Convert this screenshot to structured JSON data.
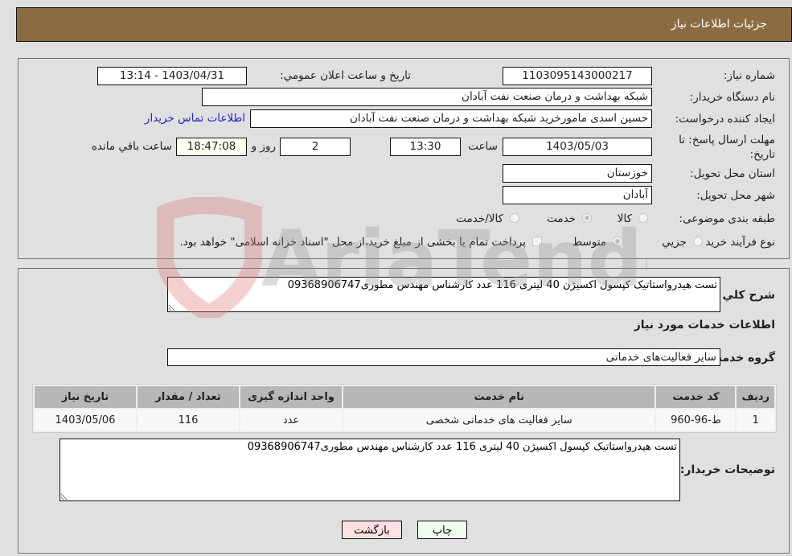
{
  "header": {
    "title": "جزئیات اطلاعات نیاز"
  },
  "details": {
    "need_number_label": "شماره نیاز:",
    "need_number": "1103095143000217",
    "announce_label": "تاریخ و ساعت اعلان عمومي:",
    "announce_value": "1403/04/31 - 13:14",
    "buyer_org_label": "نام دستگاه خریدار:",
    "buyer_org": "شبکه بهداشت و درمان صنعت نفت آبادان",
    "creator_label": "ایجاد کننده درخواست:",
    "creator": "حسین اسدی مامورخرید شبکه بهداشت و درمان صنعت نفت آبادان",
    "contact_link": "اطلاعات تماس خریدار",
    "deadline_label": "مهلت ارسال پاسخ: تا تاریخ:",
    "deadline_date": "1403/05/03",
    "time_label": "ساعت",
    "deadline_time": "13:30",
    "days_value": "2",
    "days_label": "روز و",
    "remaining_time": "18:47:08",
    "remaining_label": "ساعت باقي مانده",
    "province_label": "استان محل تحویل:",
    "province": "خوزستان",
    "city_label": "شهر محل تحویل:",
    "city": "آبادان",
    "category_label": "طبقه بندی موضوعی:",
    "category_options": [
      {
        "label": "کالا",
        "checked": false
      },
      {
        "label": "خدمت",
        "checked": true
      },
      {
        "label": "کالا/خدمت",
        "checked": false
      }
    ],
    "process_label": "نوع فرآیند خرید :",
    "process_options": [
      {
        "label": "جزيي",
        "checked": false
      },
      {
        "label": "متوسط",
        "checked": true
      }
    ],
    "treasury_checkbox_label": "پرداخت تمام یا بخشی از مبلغ خرید،از محل \"اسناد خزانه اسلامی\" خواهد بود."
  },
  "services": {
    "summary_label": "شرح كلي نياز:",
    "summary": "تست هیدرواستاتیک کپسول اکسیژن 40 لیتری 116 عدد کارشناس مهندس مطوری09368906747",
    "section_title": "اطلاعات خدمات مورد نیاز",
    "group_label": "گروه خدمت:",
    "group": "سایر فعالیت‌های خدماتی",
    "table": {
      "headers": [
        "ردیف",
        "کد خدمت",
        "نام خدمت",
        "واحد اندازه گیری",
        "تعداد / مقدار",
        "تاریخ نیاز"
      ],
      "rows": [
        [
          "1",
          "ط-96-960",
          "سایر فعالیت های خدماتی شخصی",
          "عدد",
          "116",
          "1403/05/06"
        ]
      ]
    },
    "buyer_notes_label": "توضیحات خریدار:",
    "buyer_notes": "تست هیدرواستاتیک کپسول اکسیژن 40 لیتری 116 عدد کارشناس مهندس مطوری09368906747"
  },
  "buttons": {
    "print": "چاپ",
    "back": "بازگشت"
  },
  "colors": {
    "header_bg": "#8b6c42",
    "print_bg": "#eeffee",
    "back_bg": "#ffe0e0",
    "link": "#2222cc"
  },
  "watermark": {
    "text": "AriaTender.neT"
  }
}
